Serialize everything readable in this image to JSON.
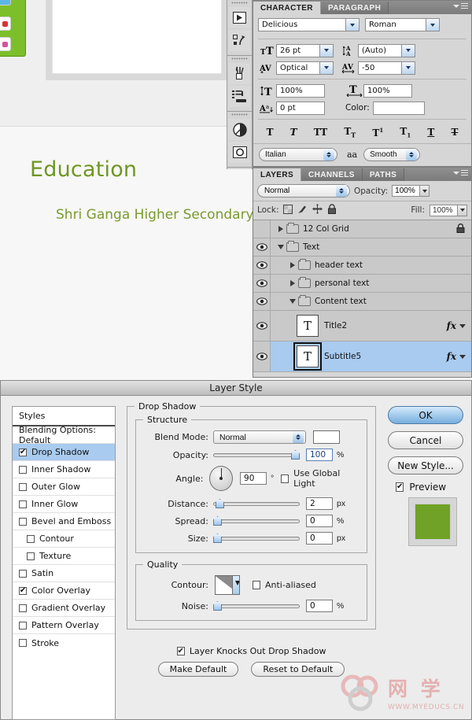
{
  "canvas": {
    "title_text": "Education",
    "subtitle_text": "Shri Ganga Higher Secondary",
    "title_color": "#6f9622",
    "subtitle_color": "#7a9a2e"
  },
  "dock": {
    "icons": [
      "play-button-icon",
      "convert-to-shape-icon",
      "brush-preset-icon",
      "tool-preset-icon",
      "mask-icon",
      "adjustment-icon"
    ]
  },
  "character_panel": {
    "tabs": [
      {
        "label": "CHARACTER",
        "active": true
      },
      {
        "label": "PARAGRAPH",
        "active": false
      }
    ],
    "font_family": "Delicious",
    "font_style": "Roman",
    "font_size": "26 pt",
    "leading": "(Auto)",
    "kerning": "Optical",
    "tracking": "-50",
    "vertical_scale": "100%",
    "horizontal_scale": "100%",
    "baseline_shift": "0 pt",
    "color_label": "Color:",
    "color_value": "#ffffff",
    "text_styles": [
      "T",
      "T",
      "TT",
      "Tr",
      "T¹",
      "T₁",
      "T",
      "T"
    ],
    "language": "Italian",
    "aa_label": "aa",
    "anti_alias": "Smooth",
    "icons": {
      "size": "font-size-icon",
      "leading": "leading-icon",
      "kerning": "kerning-icon",
      "tracking": "tracking-icon",
      "vscale": "vertical-scale-icon",
      "hscale": "horizontal-scale-icon",
      "baseline": "baseline-shift-icon"
    }
  },
  "layers_panel": {
    "tabs": [
      {
        "label": "LAYERS",
        "active": true
      },
      {
        "label": "CHANNELS",
        "active": false
      },
      {
        "label": "PATHS",
        "active": false
      }
    ],
    "blend_mode": "Normal",
    "opacity_label": "Opacity:",
    "opacity_value": "100%",
    "lock_label": "Lock:",
    "fill_label": "Fill:",
    "fill_value": "100%",
    "lock_icons": [
      "lock-transparent-pixels-icon",
      "lock-image-pixels-icon",
      "lock-position-icon",
      "lock-all-icon"
    ],
    "rows": [
      {
        "name": "12 Col Grid",
        "type": "group",
        "indent": 0,
        "expanded": false,
        "visible": false,
        "locked": true,
        "selected": false,
        "fx": false
      },
      {
        "name": "Text",
        "type": "group",
        "indent": 0,
        "expanded": true,
        "visible": true,
        "locked": false,
        "selected": false,
        "fx": false
      },
      {
        "name": "header text",
        "type": "group",
        "indent": 1,
        "expanded": false,
        "visible": true,
        "locked": false,
        "selected": false,
        "fx": false
      },
      {
        "name": "personal text",
        "type": "group",
        "indent": 1,
        "expanded": false,
        "visible": true,
        "locked": false,
        "selected": false,
        "fx": false
      },
      {
        "name": "Content text",
        "type": "group",
        "indent": 1,
        "expanded": true,
        "visible": true,
        "locked": false,
        "selected": false,
        "fx": false
      },
      {
        "name": "Title2",
        "type": "text",
        "indent": 2,
        "expanded": false,
        "visible": true,
        "locked": false,
        "selected": false,
        "fx": true
      },
      {
        "name": "Subtitle5",
        "type": "text",
        "indent": 2,
        "expanded": false,
        "visible": true,
        "locked": false,
        "selected": true,
        "fx": true
      }
    ],
    "fx_label": "fx"
  },
  "layer_style": {
    "title": "Layer Style",
    "styles_header": "Styles",
    "styles_items": [
      {
        "label": "Blending Options: Default",
        "checkbox": false,
        "checked": false,
        "selected": false,
        "indent": false
      },
      {
        "label": "Drop Shadow",
        "checkbox": true,
        "checked": true,
        "selected": true,
        "indent": false
      },
      {
        "label": "Inner Shadow",
        "checkbox": true,
        "checked": false,
        "selected": false,
        "indent": false
      },
      {
        "label": "Outer Glow",
        "checkbox": true,
        "checked": false,
        "selected": false,
        "indent": false
      },
      {
        "label": "Inner Glow",
        "checkbox": true,
        "checked": false,
        "selected": false,
        "indent": false
      },
      {
        "label": "Bevel and Emboss",
        "checkbox": true,
        "checked": false,
        "selected": false,
        "indent": false
      },
      {
        "label": "Contour",
        "checkbox": true,
        "checked": false,
        "selected": false,
        "indent": true
      },
      {
        "label": "Texture",
        "checkbox": true,
        "checked": false,
        "selected": false,
        "indent": true
      },
      {
        "label": "Satin",
        "checkbox": true,
        "checked": false,
        "selected": false,
        "indent": false
      },
      {
        "label": "Color Overlay",
        "checkbox": true,
        "checked": true,
        "selected": false,
        "indent": false
      },
      {
        "label": "Gradient Overlay",
        "checkbox": true,
        "checked": false,
        "selected": false,
        "indent": false
      },
      {
        "label": "Pattern Overlay",
        "checkbox": true,
        "checked": false,
        "selected": false,
        "indent": false
      },
      {
        "label": "Stroke",
        "checkbox": true,
        "checked": false,
        "selected": false,
        "indent": false
      }
    ],
    "section_title": "Drop Shadow",
    "structure": {
      "legend": "Structure",
      "blend_mode_label": "Blend Mode:",
      "blend_mode_value": "Normal",
      "blend_color": "#ffffff",
      "opacity_label": "Opacity:",
      "opacity_value": "100",
      "opacity_unit": "%",
      "angle_label": "Angle:",
      "angle_value": "90",
      "angle_unit": "°",
      "global_light_label": "Use Global Light",
      "global_light_checked": false,
      "distance_label": "Distance:",
      "distance_value": "2",
      "distance_unit": "px",
      "spread_label": "Spread:",
      "spread_value": "0",
      "spread_unit": "%",
      "size_label": "Size:",
      "size_value": "0",
      "size_unit": "px"
    },
    "quality": {
      "legend": "Quality",
      "contour_label": "Contour:",
      "anti_aliased_label": "Anti-aliased",
      "anti_aliased_checked": false,
      "noise_label": "Noise:",
      "noise_value": "0",
      "noise_unit": "%"
    },
    "knockout_label": "Layer Knocks Out Drop Shadow",
    "knockout_checked": true,
    "make_default": "Make Default",
    "reset_to_default": "Reset to Default",
    "buttons": {
      "ok": "OK",
      "cancel": "Cancel",
      "new_style": "New Style...",
      "preview": "Preview",
      "preview_checked": true,
      "preview_color": "#6fa226"
    }
  },
  "watermark": {
    "brand": "网 学",
    "url": "WWW.MYEDUCS.CN"
  }
}
